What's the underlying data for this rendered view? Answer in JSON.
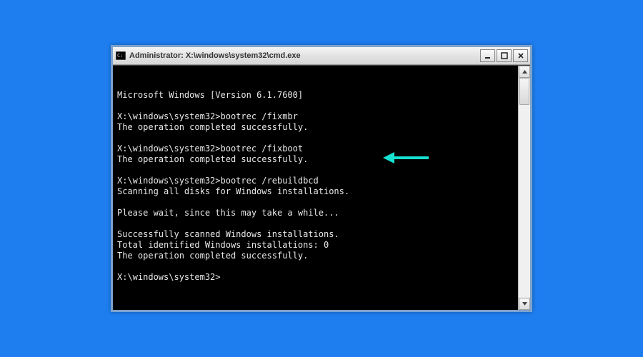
{
  "window": {
    "title": "Administrator: X:\\windows\\system32\\cmd.exe"
  },
  "terminal": {
    "lines": [
      "Microsoft Windows [Version 6.1.7600]",
      "",
      "X:\\windows\\system32>bootrec /fixmbr",
      "The operation completed successfully.",
      "",
      "X:\\windows\\system32>bootrec /fixboot",
      "The operation completed successfully.",
      "",
      "X:\\windows\\system32>bootrec /rebuildbcd",
      "Scanning all disks for Windows installations.",
      "",
      "Please wait, since this may take a while...",
      "",
      "Successfully scanned Windows installations.",
      "Total identified Windows installations: 0",
      "The operation completed successfully.",
      "",
      "X:\\windows\\system32>"
    ]
  },
  "arrow_color": "#16e0d0"
}
